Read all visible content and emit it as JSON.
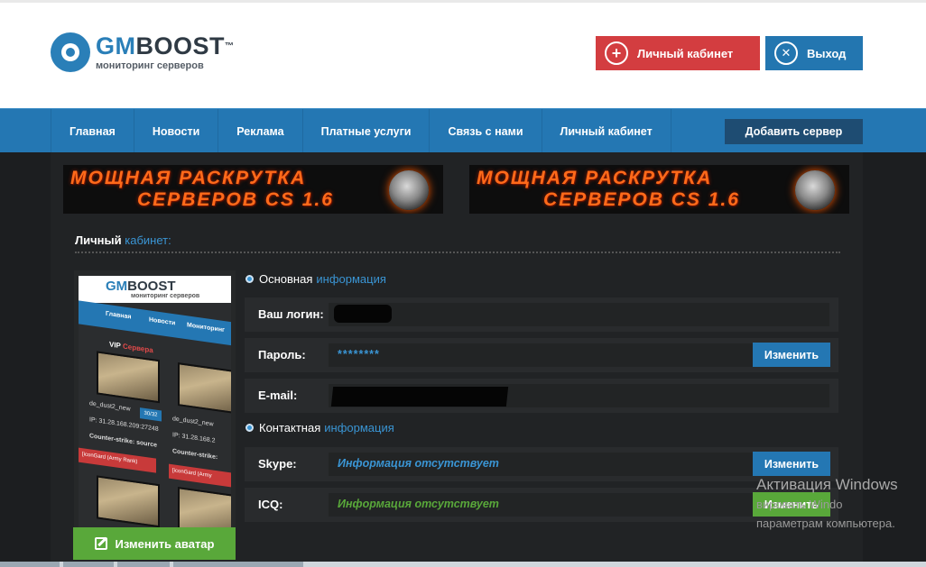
{
  "header": {
    "logo_title_gm": "GM",
    "logo_title_rest": "BOOST",
    "logo_tm": "™",
    "logo_subtitle": "мониторинг серверов",
    "cabinet_button": "Личный кабинет",
    "exit_button": "Выход",
    "cabinet_icon": "+",
    "exit_icon": "✕"
  },
  "nav": {
    "items": [
      "Главная",
      "Новости",
      "Реклама",
      "Платные услуги",
      "Связь с нами",
      "Личный кабинет"
    ],
    "add_server": "Добавить сервер"
  },
  "banners": {
    "line1": "МОЩНАЯ РАСКРУТКА",
    "line2": "СЕРВЕРОВ CS 1.6"
  },
  "page": {
    "title_main": "Личный",
    "title_accent": "кабинет:"
  },
  "avatar": {
    "logo_gm": "GM",
    "logo_rest": "BOOST",
    "logo_sub": "мониторинг серверов",
    "nav": [
      "Главная",
      "Новости",
      "Мониторинг"
    ],
    "vip_label": "VIP",
    "vip_accent": "Сервера",
    "cards": [
      {
        "map": "de_dust2_new",
        "ip": "IP: 31.28.168.209:27248",
        "game": "Counter-strike: source",
        "owner": "[iconGard (Army Rank)",
        "badge": "30/32"
      },
      {
        "map": "de_dust2_new",
        "ip": "IP: 31.28.168.2",
        "game": "Counter-strike:",
        "owner": "[iconGard (Army"
      }
    ],
    "change_button": "Изменить аватар"
  },
  "main_info": {
    "head_main": "Основная",
    "head_accent": "информация",
    "login_label": "Ваш логин:",
    "password_label": "Пароль:",
    "password_value": "********",
    "email_label": "E-mail:",
    "change_button": "Изменить"
  },
  "contact_info": {
    "head_main": "Контактная",
    "head_accent": "информация",
    "skype_label": "Skype:",
    "skype_value": "Информация отсутствует",
    "icq_label": "ICQ:",
    "icq_value": "Информация отсутствует",
    "change_button": "Изменить"
  },
  "watermark": {
    "line1": "Активация Windows",
    "line2": "вировать Windo",
    "line3": "параметрам компьютера."
  },
  "colors": {
    "brand_blue": "#2477b3",
    "accent_blue": "#3a95d4",
    "red": "#d33d40",
    "green": "#59a83a"
  }
}
